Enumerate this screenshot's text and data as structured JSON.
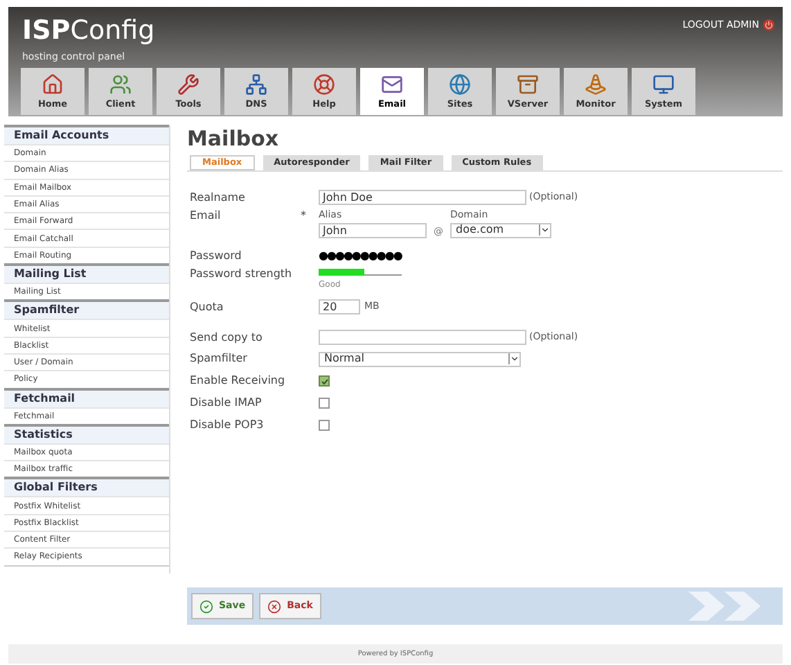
{
  "header": {
    "logo_bold": "ISP",
    "logo_rest": "Config",
    "subtitle": "hosting control panel",
    "logout": "LOGOUT ADMIN"
  },
  "nav_tabs": [
    {
      "label": "Home",
      "selected": false
    },
    {
      "label": "Client",
      "selected": false
    },
    {
      "label": "Tools",
      "selected": false
    },
    {
      "label": "DNS",
      "selected": false
    },
    {
      "label": "Help",
      "selected": false
    },
    {
      "label": "Email",
      "selected": true
    },
    {
      "label": "Sites",
      "selected": false
    },
    {
      "label": "VServer",
      "selected": false
    },
    {
      "label": "Monitor",
      "selected": false
    },
    {
      "label": "System",
      "selected": false
    }
  ],
  "sidebar": [
    {
      "title": "Email Accounts",
      "items": [
        "Domain",
        "Domain Alias",
        "Email Mailbox",
        "Email Alias",
        "Email Forward",
        "Email Catchall",
        "Email Routing"
      ]
    },
    {
      "title": "Mailing List",
      "items": [
        "Mailing List"
      ]
    },
    {
      "title": "Spamfilter",
      "items": [
        "Whitelist",
        "Blacklist",
        "User / Domain",
        "Policy"
      ]
    },
    {
      "title": "Fetchmail",
      "items": [
        "Fetchmail"
      ]
    },
    {
      "title": "Statistics",
      "items": [
        "Mailbox quota",
        "Mailbox traffic"
      ]
    },
    {
      "title": "Global Filters",
      "items": [
        "Postfix Whitelist",
        "Postfix Blacklist",
        "Content Filter",
        "Relay Recipients"
      ]
    }
  ],
  "page_title": "Mailbox",
  "tabs": [
    {
      "label": "Mailbox",
      "selected": true
    },
    {
      "label": "Autoresponder",
      "selected": false
    },
    {
      "label": "Mail Filter",
      "selected": false
    },
    {
      "label": "Custom Rules",
      "selected": false
    }
  ],
  "form": [
    {
      "kind": "text",
      "label": "Realname",
      "value": "John Doe",
      "note": "(Optional)"
    },
    {
      "kind": "email",
      "label": "Email",
      "required": "*",
      "alias_label": "Alias",
      "alias": "John",
      "at": "@",
      "domain_label": "Domain",
      "domain": "doe.com"
    },
    {
      "kind": "password",
      "label": "Password",
      "value": "●●●●●●●●●●"
    },
    {
      "kind": "strength",
      "label": "Password strength",
      "level": 0.55,
      "reading": "Good"
    },
    {
      "kind": "quota",
      "label": "Quota",
      "value": "20",
      "unit": "MB"
    },
    {
      "kind": "text",
      "label": "Send copy to",
      "note": "(Optional)"
    },
    {
      "kind": "select",
      "label": "Spamfilter",
      "value": "Normal"
    },
    {
      "kind": "checkbox",
      "label": "Enable Receiving",
      "checked": true
    },
    {
      "kind": "checkbox",
      "label": "Disable IMAP",
      "checked": false
    },
    {
      "kind": "checkbox",
      "label": "Disable POP3",
      "checked": false
    }
  ],
  "buttons": [
    {
      "kind": "save",
      "label": "Save"
    },
    {
      "kind": "back",
      "label": "Back"
    }
  ],
  "footer": "Powered by ISPConfig"
}
